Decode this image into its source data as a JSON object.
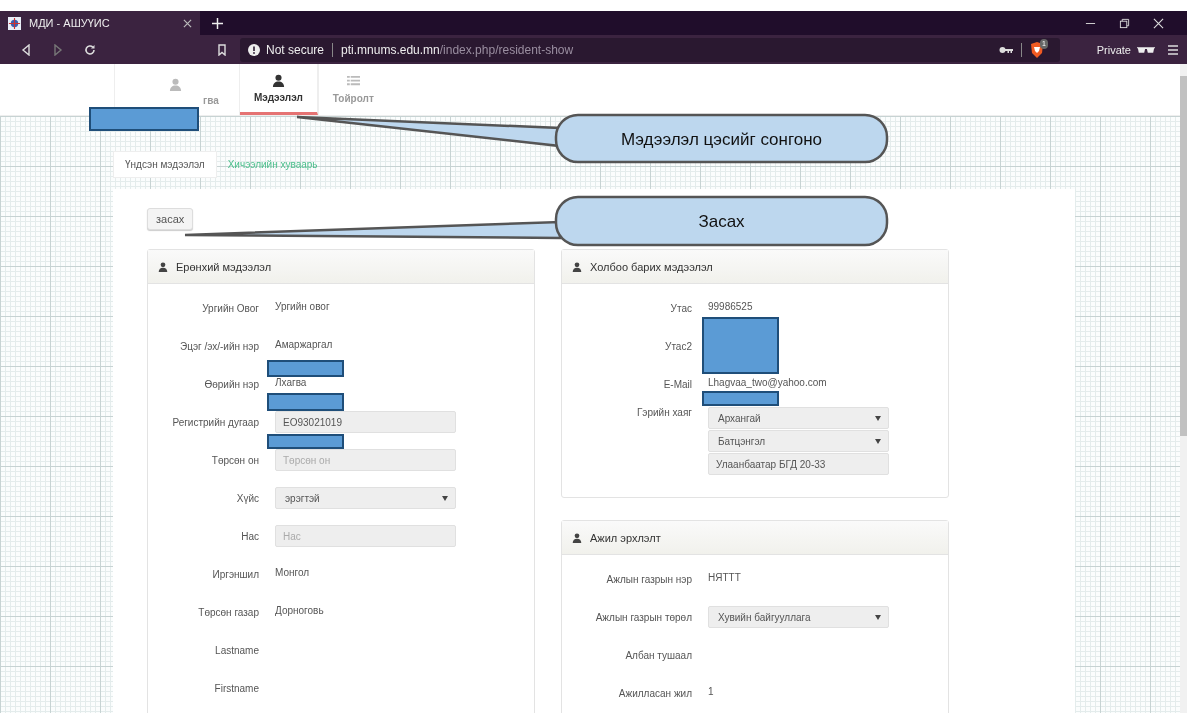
{
  "browser": {
    "tab_title": "МДИ - АШУҮИС",
    "security": "Not secure",
    "url_host": "pti.mnums.edu.mn",
    "url_path": "/index.php/resident-show",
    "shield_count": "1",
    "private_label": "Private"
  },
  "nav_tabs": [
    {
      "label": "гва",
      "selected": false
    },
    {
      "label": "Мэдээлэл",
      "selected": true
    },
    {
      "label": "Тойролт",
      "selected": false
    }
  ],
  "sub_tabs": [
    {
      "label": "Үндсэн мэдээлэл",
      "selected": true
    },
    {
      "label": "Хичээлийн хуваарь",
      "selected": false
    }
  ],
  "edit_button": "засах",
  "columns": [
    [
      {
        "title": "Ерөнхий мэдээлэл",
        "rows": [
          {
            "label": "Ургийн Овог",
            "kind": "text",
            "value": "Ургийн овог"
          },
          {
            "label": "Эцэг /эх/-ийн нэр",
            "kind": "text",
            "value": "Амаржаргал"
          },
          {
            "label": "Өөрийн нэр",
            "kind": "text",
            "value": "Лхагва"
          },
          {
            "label": "Регистрийн дугаар",
            "kind": "input",
            "value": "ЕО93021019"
          },
          {
            "label": "Төрсөн он",
            "kind": "input",
            "placeholder": "Төрсөн он"
          },
          {
            "label": "Хүйс",
            "kind": "select",
            "value": "эрэгтэй"
          },
          {
            "label": "Нас",
            "kind": "input",
            "placeholder": "Нас"
          },
          {
            "label": "Иргэншил",
            "kind": "text",
            "value": "Монгол"
          },
          {
            "label": "Төрсөн газар",
            "kind": "text",
            "value": "Дорноговь"
          },
          {
            "label": "Lastname",
            "kind": "empty"
          },
          {
            "label": "Firstname",
            "kind": "empty"
          }
        ]
      }
    ],
    [
      {
        "title": "Холбоо барих мэдээлэл",
        "rows": [
          {
            "label": "Утас",
            "kind": "text",
            "value": "99986525"
          },
          {
            "label": "Утас2",
            "kind": "empty"
          },
          {
            "label": "E-Mail",
            "kind": "text",
            "value": "Lhagvaa_two@yahoo.com"
          },
          {
            "label": "Гэрийн хаяг",
            "kind": "stack",
            "items": [
              {
                "kind": "select",
                "value": "Архангай"
              },
              {
                "kind": "select",
                "value": "Батцэнгэл"
              },
              {
                "kind": "input",
                "value": "Улаанбаатар БГД 20-33"
              }
            ]
          }
        ]
      },
      {
        "title": "Ажил эрхлэлт",
        "rows": [
          {
            "label": "Ажлын газрын нэр",
            "kind": "text",
            "value": "НЯТТТ"
          },
          {
            "label": "Ажлын газрын төрөл",
            "kind": "select",
            "value": "Хувийн байгууллага"
          },
          {
            "label": "Албан тушаал",
            "kind": "empty"
          },
          {
            "label": "Ажилласан жил",
            "kind": "text",
            "value": "1"
          }
        ]
      }
    ]
  ],
  "annotations": [
    {
      "text": "Мэдээлэл цэсийг сонгоно"
    },
    {
      "text": "Засах"
    }
  ]
}
